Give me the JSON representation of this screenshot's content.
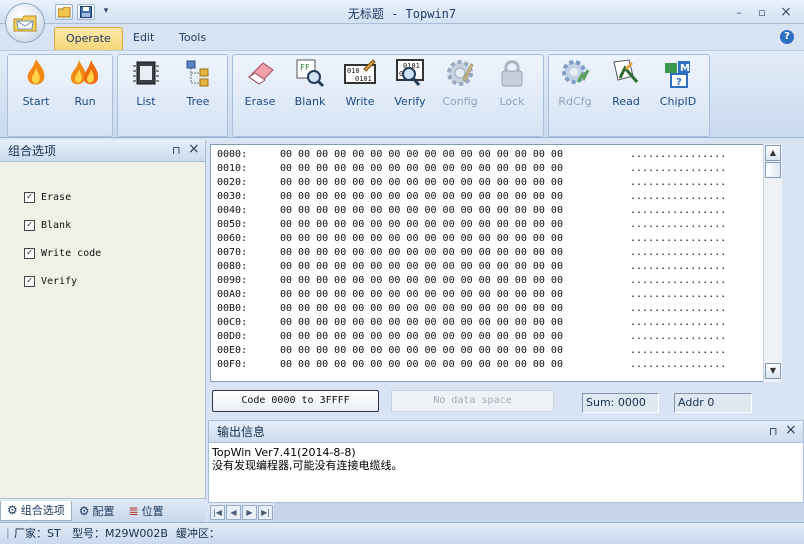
{
  "window": {
    "title": "无标题 - Topwin7",
    "minimize": "–",
    "maximize": "▫",
    "close": "×"
  },
  "tabs": [
    {
      "label": "Operate",
      "active": true
    },
    {
      "label": "Edit",
      "active": false
    },
    {
      "label": "Tools",
      "active": false
    }
  ],
  "help": "?",
  "ribbon": {
    "buttons": [
      {
        "label": "Start",
        "icon": "flame-icon"
      },
      {
        "label": "Run",
        "icon": "double-flame-icon"
      },
      {
        "label": "List",
        "icon": "chip-list-icon"
      },
      {
        "label": "Tree",
        "icon": "tree-icon"
      },
      {
        "label": "Erase",
        "icon": "eraser-icon"
      },
      {
        "label": "Blank",
        "icon": "blank-check-icon"
      },
      {
        "label": "Write",
        "icon": "write-binary-icon"
      },
      {
        "label": "Verify",
        "icon": "verify-binary-icon"
      },
      {
        "label": "Config",
        "icon": "gear-icon",
        "disabled": true
      },
      {
        "label": "Lock",
        "icon": "lock-icon",
        "disabled": true
      },
      {
        "label": "RdCfg",
        "icon": "read-config-icon",
        "disabled": true
      },
      {
        "label": "Read",
        "icon": "read-icon"
      },
      {
        "label": "ChipID",
        "icon": "chip-id-icon"
      }
    ]
  },
  "left_panel": {
    "title": "组合选项",
    "pin": "⊓",
    "close": "×",
    "options": [
      {
        "label": "Erase",
        "checked": true
      },
      {
        "label": "Blank",
        "checked": true
      },
      {
        "label": "Write code",
        "checked": true
      },
      {
        "label": "Verify",
        "checked": true
      }
    ],
    "bottom_tabs": [
      {
        "label": "组合选项",
        "icon": "combo-options-icon",
        "active": true
      },
      {
        "label": "配置",
        "icon": "gear-icon",
        "active": false
      },
      {
        "label": "位置",
        "icon": "position-icon",
        "active": false
      }
    ]
  },
  "hex": {
    "rows": [
      {
        "addr": "0000:",
        "bytes": "00 00 00 00 00 00 00 00 00 00 00 00 00 00 00 00",
        "ascii": "................"
      },
      {
        "addr": "0010:",
        "bytes": "00 00 00 00 00 00 00 00 00 00 00 00 00 00 00 00",
        "ascii": "................"
      },
      {
        "addr": "0020:",
        "bytes": "00 00 00 00 00 00 00 00 00 00 00 00 00 00 00 00",
        "ascii": "................"
      },
      {
        "addr": "0030:",
        "bytes": "00 00 00 00 00 00 00 00 00 00 00 00 00 00 00 00",
        "ascii": "................"
      },
      {
        "addr": "0040:",
        "bytes": "00 00 00 00 00 00 00 00 00 00 00 00 00 00 00 00",
        "ascii": "................"
      },
      {
        "addr": "0050:",
        "bytes": "00 00 00 00 00 00 00 00 00 00 00 00 00 00 00 00",
        "ascii": "................"
      },
      {
        "addr": "0060:",
        "bytes": "00 00 00 00 00 00 00 00 00 00 00 00 00 00 00 00",
        "ascii": "................"
      },
      {
        "addr": "0070:",
        "bytes": "00 00 00 00 00 00 00 00 00 00 00 00 00 00 00 00",
        "ascii": "................"
      },
      {
        "addr": "0080:",
        "bytes": "00 00 00 00 00 00 00 00 00 00 00 00 00 00 00 00",
        "ascii": "................"
      },
      {
        "addr": "0090:",
        "bytes": "00 00 00 00 00 00 00 00 00 00 00 00 00 00 00 00",
        "ascii": "................"
      },
      {
        "addr": "00A0:",
        "bytes": "00 00 00 00 00 00 00 00 00 00 00 00 00 00 00 00",
        "ascii": "................"
      },
      {
        "addr": "00B0:",
        "bytes": "00 00 00 00 00 00 00 00 00 00 00 00 00 00 00 00",
        "ascii": "................"
      },
      {
        "addr": "00C0:",
        "bytes": "00 00 00 00 00 00 00 00 00 00 00 00 00 00 00 00",
        "ascii": "................"
      },
      {
        "addr": "00D0:",
        "bytes": "00 00 00 00 00 00 00 00 00 00 00 00 00 00 00 00",
        "ascii": "................"
      },
      {
        "addr": "00E0:",
        "bytes": "00 00 00 00 00 00 00 00 00 00 00 00 00 00 00 00",
        "ascii": "................"
      },
      {
        "addr": "00F0:",
        "bytes": "00 00 00 00 00 00 00 00 00 00 00 00 00 00 00 00",
        "ascii": "................"
      }
    ]
  },
  "toolbar2": {
    "code_range": "Code 0000 to 3FFFF",
    "no_data": "No data space",
    "sum": "Sum: 0000",
    "addr": "Addr 0"
  },
  "output": {
    "title": "输出信息",
    "lines": [
      "TopWin Ver7.41(2014-8-8)",
      "没有发现编程器,可能没有连接电缆线。"
    ]
  },
  "status": {
    "vendor": "厂家：ST",
    "model": "型号：M29W002B",
    "buffer": "缓冲区："
  }
}
